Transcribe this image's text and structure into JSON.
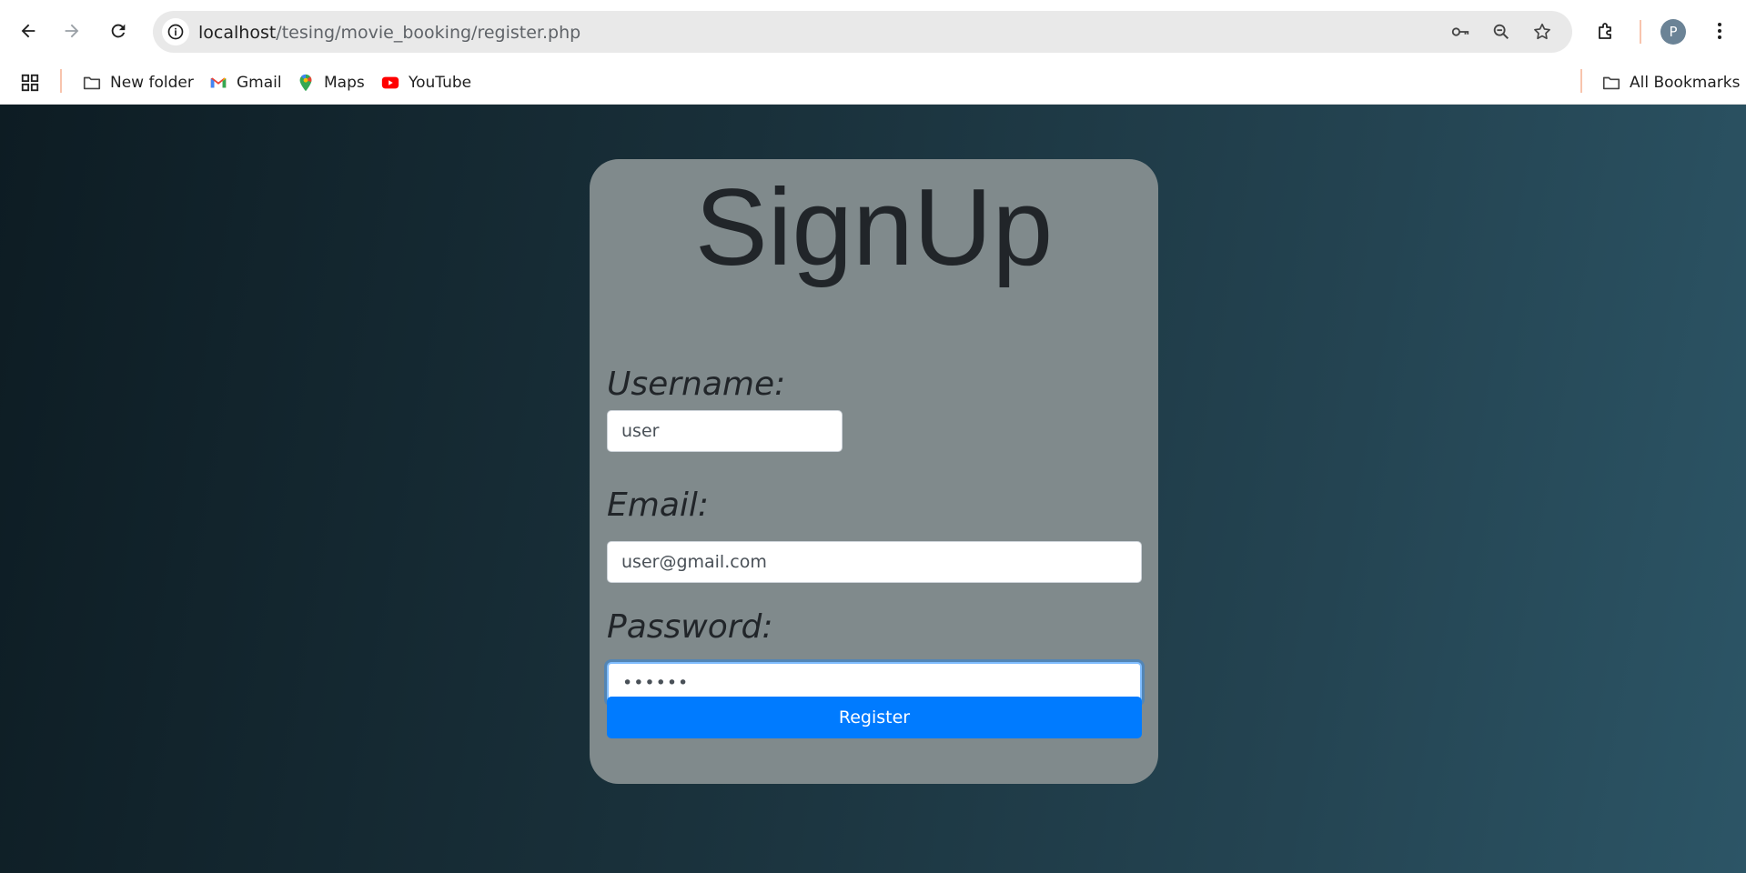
{
  "browser": {
    "url_host": "localhost",
    "url_path": "/tesing/movie_booking/register.php",
    "profile_initial": "P",
    "accent_color": "#f8c4ad"
  },
  "bookmarks": {
    "items": [
      {
        "label": "New folder",
        "icon": "folder-icon"
      },
      {
        "label": "Gmail",
        "icon": "gmail-icon"
      },
      {
        "label": "Maps",
        "icon": "maps-icon"
      },
      {
        "label": "YouTube",
        "icon": "youtube-icon"
      }
    ],
    "all_bookmarks": "All Bookmarks"
  },
  "form": {
    "title": "SignUp",
    "username_label": "Username:",
    "username_value": "user",
    "email_label": "Email:",
    "email_value": "user@gmail.com",
    "password_label": "Password:",
    "password_value": "••••••",
    "submit_label": "Register",
    "button_color": "#007bff",
    "card_color": "#808a8c"
  }
}
